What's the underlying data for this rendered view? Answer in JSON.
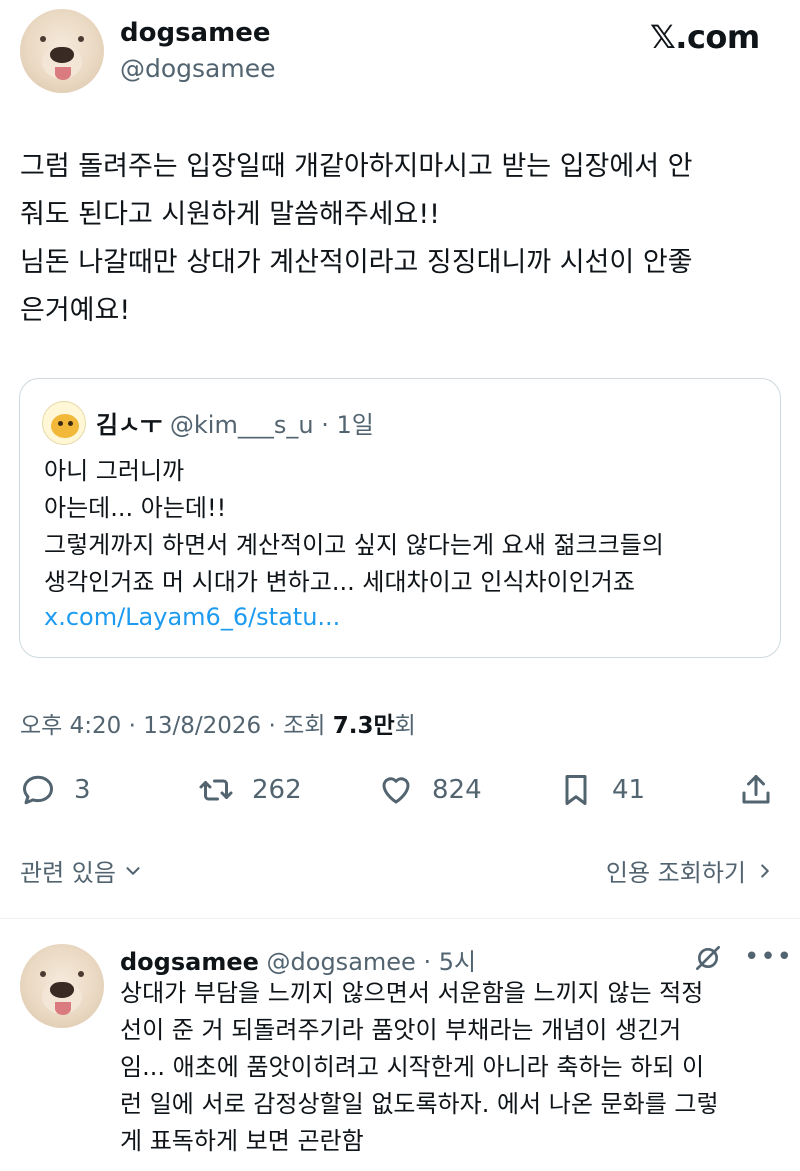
{
  "post": {
    "author_name": "dogsamee",
    "author_handle": "@dogsamee",
    "brand": "𝕏.com",
    "text_lines": [
      "그럼 돌려주는 입장일때 개같아하지마시고 받는 입장에서 안",
      "줘도 된다고 시원하게 말씀해주세요!!",
      "님돈 나갈때만 상대가 계산적이라고 징징대니까 시선이 안좋",
      "은거예요!"
    ]
  },
  "quoted": {
    "author_name": "김ㅅㅜ",
    "author_handle": "@kim___s_u",
    "separator": "·",
    "time": "1일",
    "text_lines": [
      "아니 그러니까",
      "아는데... 아는데!!",
      "그렇게까지 하면서 계산적이고 싶지 않다는게 요새 젊크크들의",
      "생각인거죠 머 시대가 변하고...  세대차이고 인식차이인거죠"
    ],
    "link": "x.com/Layam6_6/statu..."
  },
  "meta": {
    "time": "오후 4:20",
    "sep1": " · ",
    "date": "13/8/2026",
    "sep2": " · ",
    "views_label": "조회 ",
    "views_num": "7.3",
    "views_unit": "만회"
  },
  "actions": {
    "replies": "3",
    "reposts": "262",
    "likes": "824",
    "bookmarks": "41"
  },
  "related": {
    "label": "관련 있음",
    "quote_views": "인용 조회하기"
  },
  "reply": {
    "author_name": "dogsamee",
    "author_handle": "@dogsamee",
    "separator": "·",
    "time": "5시",
    "text_lines": [
      "상대가 부담을 느끼지 않으면서 서운함을 느끼지 않는 적정",
      "선이 준 거 되돌려주기라 품앗이 부채라는 개념이 생긴거",
      "임... 애초에 품앗이히려고 시작한게 아니라 축하는 하되 이",
      "런 일에 서로 감정상할일 없도록하자. 에서 나온 문화를 그렇",
      "게 표독하게 보면 곤란함"
    ]
  },
  "icons": {
    "reply": "speech-bubble-icon",
    "repost": "repost-arrows-icon",
    "like": "heart-icon",
    "bookmark": "bookmark-icon",
    "share": "share-upload-icon",
    "more": "more-dots-icon",
    "grok": "grok-icon"
  },
  "colors": {
    "text": "#0f1419",
    "secondary": "#536471",
    "link": "#1d9bf0",
    "border": "#cfd9de"
  }
}
